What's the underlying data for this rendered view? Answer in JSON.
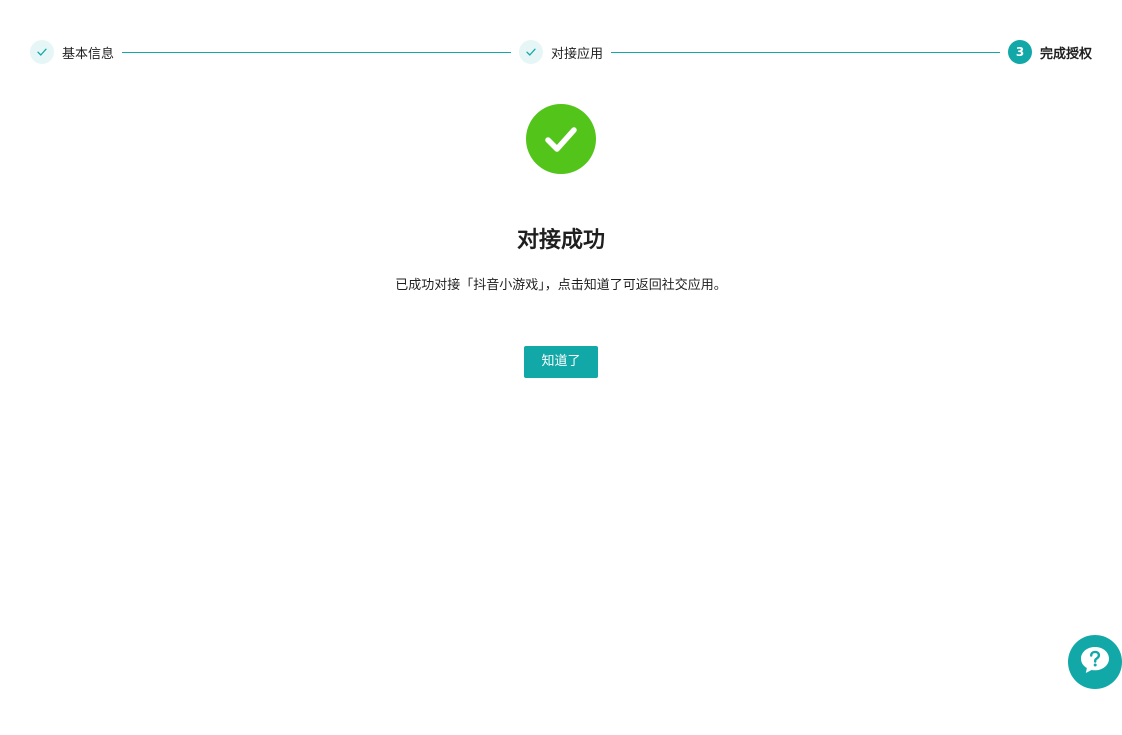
{
  "steps": [
    {
      "label": "基本信息",
      "status": "done"
    },
    {
      "label": "对接应用",
      "status": "done"
    },
    {
      "label": "完成授权",
      "status": "active",
      "number": "3"
    }
  ],
  "result": {
    "status": "success",
    "icon": "check-circle-icon",
    "title": "对接成功",
    "description": "已成功对接「抖音小游戏」，点击知道了可返回社交应用。",
    "button_label": "知道了"
  },
  "help": {
    "icon": "question-icon"
  },
  "colors": {
    "accent": "#13a8a8",
    "success": "#52c41a",
    "step_done_bg": "#e6f6f6"
  }
}
